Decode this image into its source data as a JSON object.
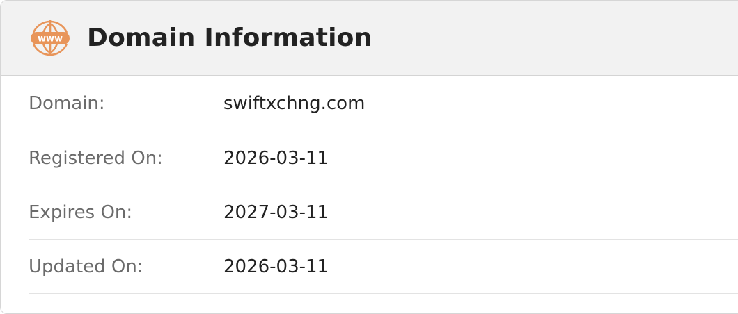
{
  "header": {
    "icon": "www-globe-icon",
    "icon_text": "www",
    "title": "Domain Information",
    "accent_color": "#e8955a"
  },
  "rows": [
    {
      "label": "Domain:",
      "value": "swiftxchng.com"
    },
    {
      "label": "Registered On:",
      "value": "2026-03-11"
    },
    {
      "label": "Expires On:",
      "value": "2027-03-11"
    },
    {
      "label": "Updated On:",
      "value": "2026-03-11"
    }
  ]
}
